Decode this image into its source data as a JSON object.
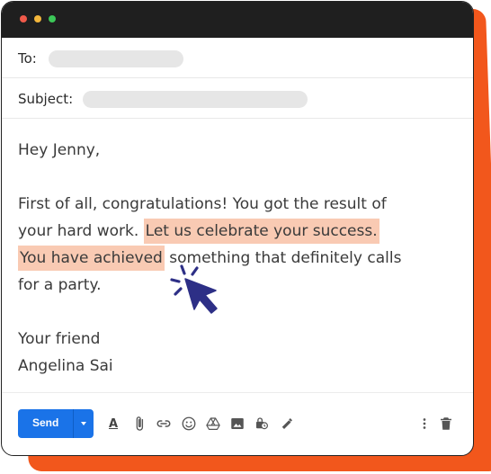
{
  "compose": {
    "to_label": "To:",
    "subject_label": "Subject:",
    "body": {
      "greeting": "Hey Jenny,",
      "line1": "First of all, congratulations! You got the result of",
      "line2_plain": "your hard work. ",
      "line2_highlight": "Let us celebrate your success.",
      "line3_highlight": "You have achieved",
      "line3_plain": " something that definitely calls",
      "line4": "for a party.",
      "signoff": "Your friend",
      "signature": "Angelina Sai"
    },
    "highlight_color": "#f9cab3"
  },
  "toolbar": {
    "send_label": "Send",
    "send_color": "#1a73e8",
    "icons": [
      "font-color-icon",
      "attach-icon",
      "link-icon",
      "emoji-icon",
      "drive-icon",
      "photo-icon",
      "confidential-icon",
      "signature-icon",
      "more-vert-icon",
      "trash-icon"
    ]
  },
  "window": {
    "shadow_color": "#f2571c",
    "dots": [
      "#f05a4a",
      "#f4b73c",
      "#3cc758"
    ]
  }
}
